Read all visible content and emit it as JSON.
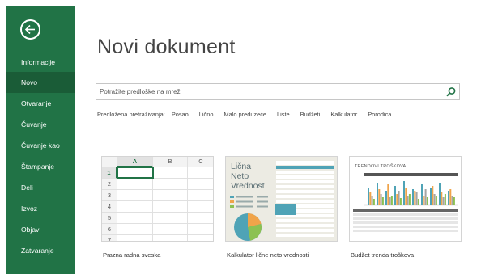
{
  "sidebar": {
    "items": [
      {
        "label": "Informacije",
        "active": false
      },
      {
        "label": "Novo",
        "active": true
      },
      {
        "label": "Otvaranje",
        "active": false
      },
      {
        "label": "Čuvanje",
        "active": false
      },
      {
        "label": "Čuvanje kao",
        "active": false
      },
      {
        "label": "Štampanje",
        "active": false
      },
      {
        "label": "Deli",
        "active": false
      },
      {
        "label": "Izvoz",
        "active": false
      },
      {
        "label": "Objavi",
        "active": false
      },
      {
        "label": "Zatvaranje",
        "active": false
      }
    ],
    "color": "#217346"
  },
  "main": {
    "title": "Novi dokument",
    "search": {
      "placeholder": "Potražite predloške na mreži"
    },
    "suggested": {
      "label": "Predložena pretraživanja:",
      "items": [
        "Posao",
        "Lično",
        "Malo preduzeće",
        "Liste",
        "Budžeti",
        "Kalkulator",
        "Porodica"
      ]
    },
    "templates": [
      {
        "caption": "Prazna radna sveska",
        "columns": [
          "A",
          "B",
          "C"
        ],
        "rows": [
          "1",
          "2",
          "3",
          "4",
          "5",
          "6",
          "7"
        ]
      },
      {
        "caption": "Kalkulator lične neto vrednosti",
        "heading_lines": [
          "Lična",
          "Neto",
          "Vrednost"
        ]
      },
      {
        "caption": "Budžet trenda troškova",
        "heading": "TRENDOVI TROŠKOVA"
      }
    ]
  }
}
